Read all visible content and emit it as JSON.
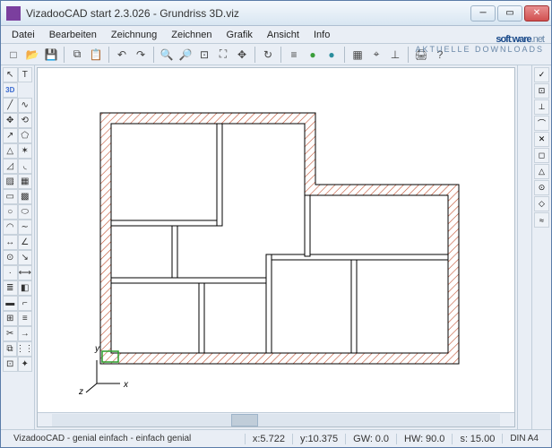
{
  "window": {
    "title": "VizadooCAD start 2.3.026  - Grundriss 3D.viz"
  },
  "menu": {
    "items": [
      "Datei",
      "Bearbeiten",
      "Zeichnung",
      "Zeichnen",
      "Grafik",
      "Ansicht",
      "Info"
    ]
  },
  "watermark": {
    "brand_a": "soft",
    "brand_b": "ware",
    "brand_c": ".net",
    "sub": "AKTUELLE DOWNLOADS"
  },
  "toolbar": {
    "icons": [
      "new-file-icon",
      "open-file-icon",
      "save-icon",
      "sep",
      "copy-icon",
      "paste-icon",
      "sep",
      "undo-icon",
      "redo-icon",
      "sep",
      "zoom-in-icon",
      "zoom-out-icon",
      "zoom-window-icon",
      "zoom-fit-icon",
      "pan-icon",
      "sep",
      "redraw-icon",
      "sep",
      "layer-icon",
      "color-swatch-green",
      "color-swatch-teal",
      "sep",
      "grid-toggle-icon",
      "snap-icon",
      "ortho-icon",
      "sep",
      "print-icon",
      "help-icon"
    ],
    "glyphs": {
      "new-file-icon": "□",
      "open-file-icon": "📂",
      "save-icon": "💾",
      "copy-icon": "⧉",
      "paste-icon": "📋",
      "undo-icon": "↶",
      "redo-icon": "↷",
      "zoom-in-icon": "🔍",
      "zoom-out-icon": "🔎",
      "zoom-window-icon": "⊡",
      "zoom-fit-icon": "⛶",
      "pan-icon": "✥",
      "redraw-icon": "↻",
      "layer-icon": "≡",
      "color-swatch-green": "●",
      "color-swatch-teal": "●",
      "grid-toggle-icon": "▦",
      "snap-icon": "⌖",
      "ortho-icon": "⊥",
      "print-icon": "🖨",
      "help-icon": "?"
    }
  },
  "left_tools": {
    "rows": [
      [
        "pointer-tool",
        "text-tool"
      ],
      [
        "3d-toggle",
        ""
      ],
      [
        "line-tool",
        "polyline-tool"
      ],
      [
        "move-tool",
        "rotate-tool"
      ],
      [
        "arrow-tool",
        "polygon-tool"
      ],
      [
        "triangle-tool",
        "star-tool"
      ],
      [
        "chamfer-tool",
        "fillet-tool"
      ],
      [
        "hatch-tool",
        "grid-tool"
      ],
      [
        "rect-tool",
        "hatch-rect-tool"
      ],
      [
        "circle-tool",
        "ellipse-tool"
      ],
      [
        "arc-tool",
        "spline-tool"
      ],
      [
        "dim-linear-tool",
        "dim-angle-tool"
      ],
      [
        "dim-radius-tool",
        "leader-tool"
      ],
      [
        "point-tool",
        "measure-tool"
      ],
      [
        "layer-tool",
        "color-tool"
      ],
      [
        "wall-tool",
        "door-tool"
      ],
      [
        "window-tool",
        "stairs-tool"
      ],
      [
        "trim-tool",
        "extend-tool"
      ],
      [
        "mirror-tool",
        "array-tool"
      ],
      [
        "group-tool",
        "explode-tool"
      ]
    ],
    "glyphs": {
      "pointer-tool": "↖",
      "text-tool": "T",
      "3d-toggle": "3D",
      "line-tool": "╱",
      "polyline-tool": "∿",
      "move-tool": "✥",
      "rotate-tool": "⟲",
      "arrow-tool": "↗",
      "polygon-tool": "⬠",
      "triangle-tool": "△",
      "star-tool": "✶",
      "chamfer-tool": "◿",
      "fillet-tool": "◟",
      "hatch-tool": "▨",
      "grid-tool": "▦",
      "rect-tool": "▭",
      "hatch-rect-tool": "▩",
      "circle-tool": "○",
      "ellipse-tool": "⬭",
      "arc-tool": "◠",
      "spline-tool": "∼",
      "dim-linear-tool": "↔",
      "dim-angle-tool": "∠",
      "dim-radius-tool": "⊙",
      "leader-tool": "↘",
      "point-tool": "·",
      "measure-tool": "⟷",
      "layer-tool": "≣",
      "color-tool": "◧",
      "wall-tool": "▬",
      "door-tool": "⌐",
      "window-tool": "⊞",
      "stairs-tool": "≡",
      "trim-tool": "✂",
      "extend-tool": "→",
      "mirror-tool": "⧉",
      "array-tool": "⋮⋮",
      "group-tool": "⊡",
      "explode-tool": "✦"
    }
  },
  "right_tools": {
    "items": [
      "check-icon",
      "node-edit-icon",
      "perpend-icon",
      "tangent-icon",
      "intersect-icon",
      "endpoint-icon",
      "midpoint-icon",
      "center-icon",
      "quad-icon",
      "near-icon"
    ],
    "glyphs": {
      "check-icon": "✓",
      "node-edit-icon": "⊡",
      "perpend-icon": "⊥",
      "tangent-icon": "⌒",
      "intersect-icon": "✕",
      "endpoint-icon": "◻",
      "midpoint-icon": "△",
      "center-icon": "⊙",
      "quad-icon": "◇",
      "near-icon": "≈"
    }
  },
  "axes": {
    "x": "x",
    "y": "y",
    "z": "z"
  },
  "status": {
    "tagline": "VizadooCAD - genial einfach - einfach genial",
    "x_label": "x:",
    "x_val": "5.722",
    "y_label": "y:",
    "y_val": "10.375",
    "gw_label": "GW:",
    "gw_val": "0.0",
    "hw_label": "HW:",
    "hw_val": "90.0",
    "s_label": "s:",
    "s_val": "15.00",
    "paper": "DIN A4"
  }
}
